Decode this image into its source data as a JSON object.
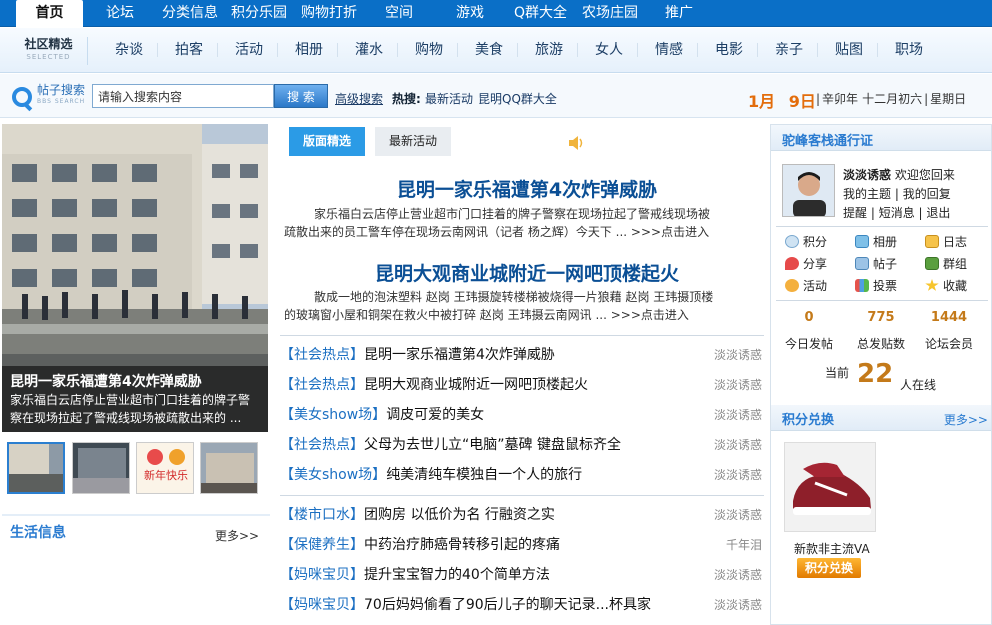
{
  "topnav": [
    "首页",
    "论坛",
    "分类信息",
    "积分乐园",
    "购物打折",
    "空间",
    "游戏",
    "Q群大全",
    "农场庄园",
    "推广"
  ],
  "subnav": {
    "label_cn": "社区精选",
    "label_en": "SELECTED",
    "categories": [
      "杂谈",
      "拍客",
      "活动",
      "相册",
      "灌水",
      "购物",
      "美食",
      "旅游",
      "女人",
      "情感",
      "电影",
      "亲子",
      "贴图",
      "职场"
    ]
  },
  "search": {
    "title_cn": "帖子搜索",
    "title_en": "BBS SEARCH",
    "placeholder": "请输入搜索内容",
    "button": "搜 索",
    "advanced": "高级搜索",
    "hot_label": "热搜:",
    "hot1": "最新活动",
    "hot2": "昆明QQ群大全"
  },
  "date": {
    "month": "1月",
    "day": "9日",
    "lunar": [
      "辛卯年",
      "十二月初六",
      "星期日"
    ]
  },
  "slideshow": {
    "title": "昆明一家乐福遭第4次炸弹威胁",
    "desc": "家乐福白云店停止营业超市门口挂着的牌子警察在现场拉起了警戒线现场被疏散出来的 ..."
  },
  "life": {
    "title": "生活信息",
    "more": "更多>>"
  },
  "tabs": {
    "tab1": "版面精选",
    "tab2": "最新活动"
  },
  "features": [
    {
      "title": "昆明一家乐福遭第4次炸弹威胁",
      "desc": "家乐福白云店停止营业超市门口挂着的牌子警察在现场拉起了警戒线现场被疏散出来的员工警车停在现场云南网讯（记者 杨之辉）今天下 ...",
      "more": ">>>点击进入"
    },
    {
      "title": "昆明大观商业城附近一网吧顶楼起火",
      "desc": "散成一地的泡沫塑料 赵岗 王玮摄旋转楼梯被烧得一片狼藉 赵岗 王玮摄顶楼的玻璃窗小屋和铜架在救火中被打碎 赵岗 王玮摄云南网讯 ...",
      "more": ">>>点击进入"
    }
  ],
  "news": [
    {
      "cat": "【社会热点】",
      "title": "昆明一家乐福遭第4次炸弹威胁",
      "author": "淡淡诱惑"
    },
    {
      "cat": "【社会热点】",
      "title": "昆明大观商业城附近一网吧顶楼起火",
      "author": "淡淡诱惑"
    },
    {
      "cat": "【美女show场】",
      "title": "调皮可爱的美女",
      "author": "淡淡诱惑"
    },
    {
      "cat": "【社会热点】",
      "title": "父母为去世儿立“电脑”墓碑 键盘鼠标齐全",
      "author": "淡淡诱惑"
    },
    {
      "cat": "【美女show场】",
      "title": "纯美清纯车模独自一个人的旅行",
      "author": "淡淡诱惑"
    },
    {
      "cat": "【楼市口水】",
      "title": "团购房 以低价为名 行融资之实",
      "author": "淡淡诱惑"
    },
    {
      "cat": "【保健养生】",
      "title": "中药治疗肺癌骨转移引起的疼痛",
      "author": "千年泪"
    },
    {
      "cat": "【妈咪宝贝】",
      "title": "提升宝宝智力的40个简单方法",
      "author": "淡淡诱惑"
    },
    {
      "cat": "【妈咪宝贝】",
      "title": "70后妈妈偷看了90后儿子的聊天记录...杯具家",
      "author": "淡淡诱惑"
    }
  ],
  "pass": {
    "title": "驼峰客栈通行证",
    "username": "淡淡诱惑",
    "welcome": "欢迎您回来",
    "my_topics": "我的主题",
    "my_replies": "我的回复",
    "remind": "提醒",
    "pm": "短消息",
    "logout": "退出",
    "links": [
      "积分",
      "相册",
      "日志",
      "分享",
      "帖子",
      "群组",
      "活动",
      "投票",
      "收藏"
    ],
    "stats": [
      {
        "num": "0",
        "label": "今日发帖"
      },
      {
        "num": "775",
        "label": "总发贴数"
      },
      {
        "num": "1444",
        "label": "论坛会员"
      }
    ],
    "online_prefix": "当前",
    "online_count": "22",
    "online_suffix": "人在线"
  },
  "exchange": {
    "title": "积分兑换",
    "more": "更多>>",
    "product": "新款非主流VA",
    "button": "积分兑换"
  },
  "colors": {
    "nav_blue": "#0a6fc7",
    "accent_blue": "#2b9be6",
    "headline_blue": "#0b4f95",
    "orange": "#e36d0c"
  }
}
